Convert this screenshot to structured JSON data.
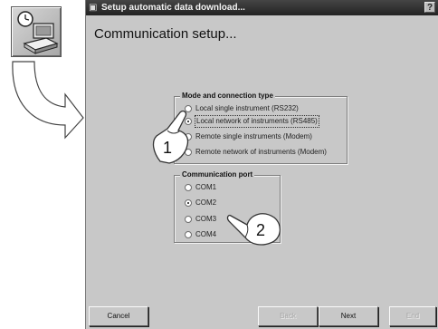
{
  "window": {
    "title": "Setup automatic data download...",
    "help_label": "?",
    "heading": "Communication setup..."
  },
  "mode_group": {
    "title": "Mode and connection type",
    "options": [
      {
        "label": "Local single instrument (RS232)",
        "checked": false
      },
      {
        "label": "Local network of instruments (RS485)",
        "checked": true
      },
      {
        "label": "Remote single instruments (Modem)",
        "checked": false
      },
      {
        "label": "Remote network of instruments (Modem)",
        "checked": false
      }
    ]
  },
  "port_group": {
    "title": "Communication port",
    "options": [
      {
        "label": "COM1",
        "checked": false
      },
      {
        "label": "COM2",
        "checked": true
      },
      {
        "label": "COM3",
        "checked": false
      },
      {
        "label": "COM4",
        "checked": false
      }
    ]
  },
  "callouts": {
    "step1": "1",
    "step2": "2"
  },
  "buttons": {
    "cancel": "Cancel",
    "back": "Back",
    "next": "Next",
    "end": "End"
  }
}
